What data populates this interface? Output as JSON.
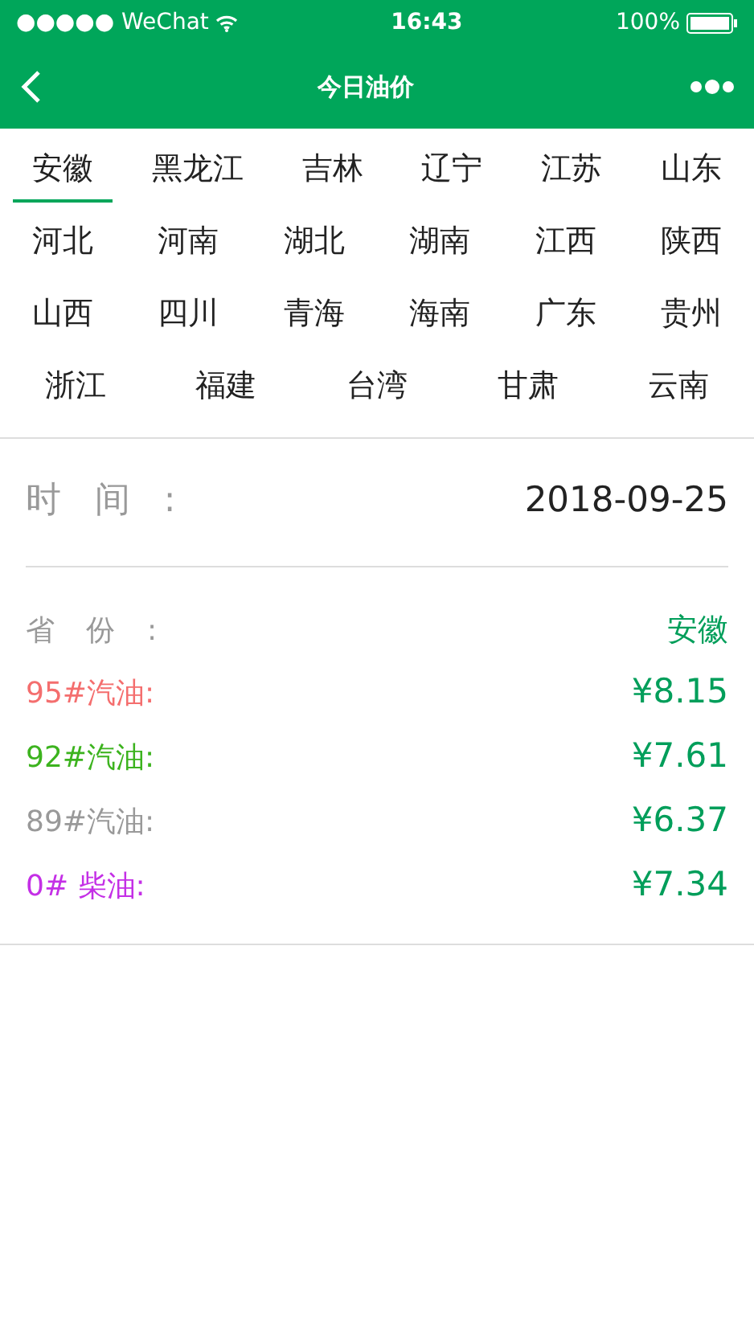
{
  "status_bar": {
    "carrier": "●●●●● WeChat",
    "time": "16:43",
    "battery": "100%"
  },
  "nav_bar": {
    "title": "今日油价"
  },
  "provinces": [
    {
      "label": "安徽",
      "selected": true
    },
    {
      "label": "黑龙江",
      "selected": false
    },
    {
      "label": "吉林",
      "selected": false
    },
    {
      "label": "辽宁",
      "selected": false
    },
    {
      "label": "江苏",
      "selected": false
    },
    {
      "label": "山东",
      "selected": false
    },
    {
      "label": "河北",
      "selected": false
    },
    {
      "label": "河南",
      "selected": false
    },
    {
      "label": "湖北",
      "selected": false
    },
    {
      "label": "湖南",
      "selected": false
    },
    {
      "label": "江西",
      "selected": false
    },
    {
      "label": "陕西",
      "selected": false
    },
    {
      "label": "山西",
      "selected": false
    },
    {
      "label": "四川",
      "selected": false
    },
    {
      "label": "青海",
      "selected": false
    },
    {
      "label": "海南",
      "selected": false
    },
    {
      "label": "广东",
      "selected": false
    },
    {
      "label": "贵州",
      "selected": false
    },
    {
      "label": "浙江",
      "selected": false
    },
    {
      "label": "福建",
      "selected": false
    },
    {
      "label": "台湾",
      "selected": false
    },
    {
      "label": "甘肃",
      "selected": false
    },
    {
      "label": "云南",
      "selected": false
    }
  ],
  "time_row": {
    "label": "时 间 :",
    "value": "2018-09-25"
  },
  "province_row": {
    "label": "省 份 :",
    "value": "安徽"
  },
  "prices": [
    {
      "label": "95#汽油:",
      "value": "¥8.15",
      "color": "#f46e6e"
    },
    {
      "label": "92#汽油:",
      "value": "¥7.61",
      "color": "#3cb31e"
    },
    {
      "label": "89#汽油:",
      "value": "¥6.37",
      "color": "#999999"
    },
    {
      "label": "0# 柴油:",
      "value": "¥7.34",
      "color": "#c42fe6"
    }
  ]
}
